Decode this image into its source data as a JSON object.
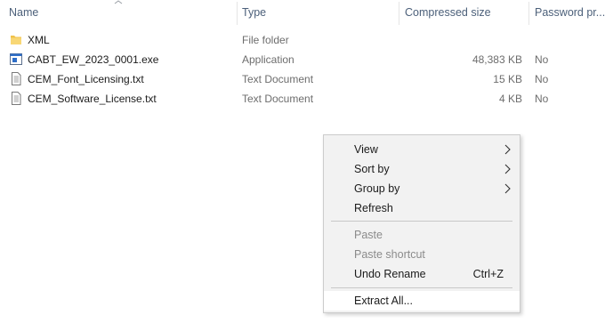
{
  "columns": {
    "name": "Name",
    "type": "Type",
    "compressed_size": "Compressed size",
    "password": "Password pr..."
  },
  "files": [
    {
      "name": "XML",
      "type": "File folder",
      "size": "",
      "password": "",
      "icon": "folder-icon"
    },
    {
      "name": "CABT_EW_2023_0001.exe",
      "type": "Application",
      "size": "48,383 KB",
      "password": "No",
      "icon": "application-icon"
    },
    {
      "name": "CEM_Font_Licensing.txt",
      "type": "Text Document",
      "size": "15 KB",
      "password": "No",
      "icon": "text-document-icon"
    },
    {
      "name": "CEM_Software_License.txt",
      "type": "Text Document",
      "size": "4 KB",
      "password": "No",
      "icon": "text-document-icon"
    }
  ],
  "context_menu": {
    "view": "View",
    "sort_by": "Sort by",
    "group_by": "Group by",
    "refresh": "Refresh",
    "paste": "Paste",
    "paste_shortcut": "Paste shortcut",
    "undo_rename": "Undo Rename",
    "undo_rename_shortcut": "Ctrl+Z",
    "extract_all": "Extract All..."
  },
  "colors": {
    "header_text": "#4c607a",
    "folder": "#f0c24a",
    "menu_bg": "#f2f2f2",
    "disabled_text": "#8b8b8b"
  }
}
